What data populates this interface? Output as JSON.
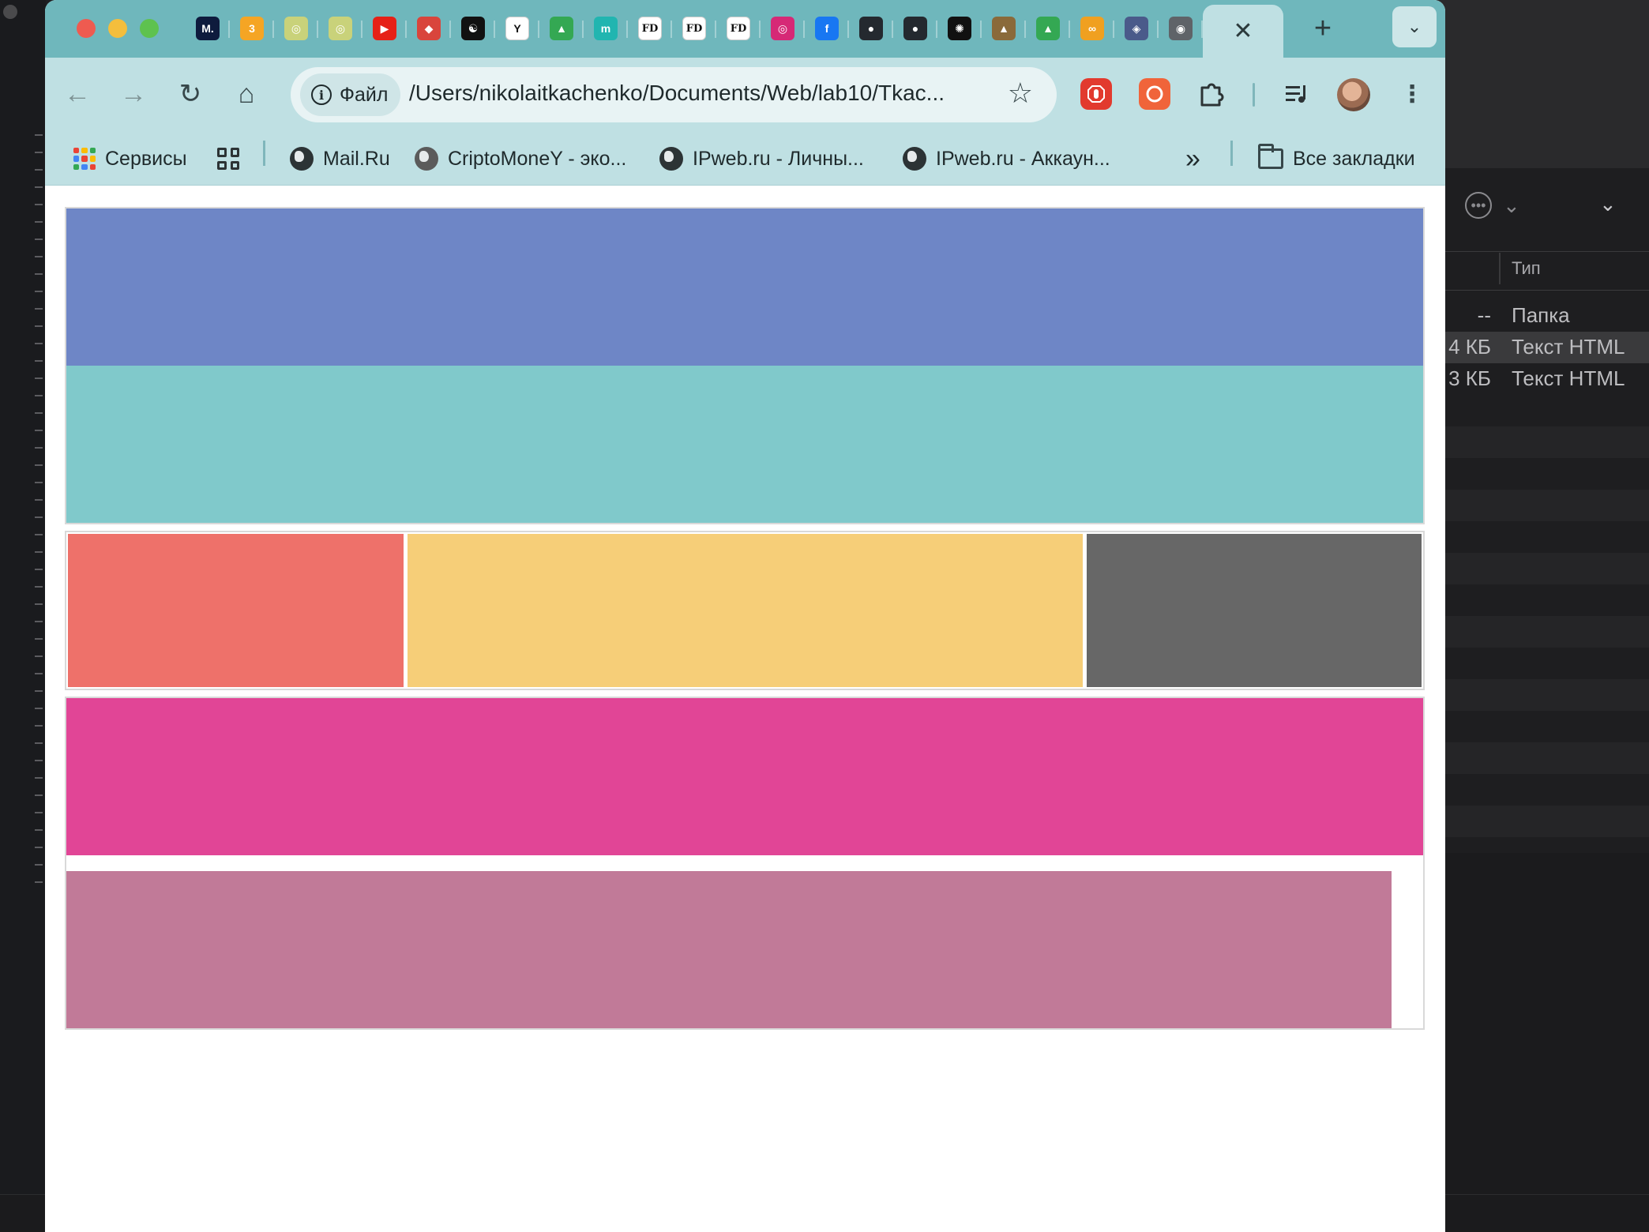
{
  "browser": {
    "tab_favicons": [
      {
        "name": "metamask-icon",
        "bg": "#0e1b3d",
        "glyph": "M."
      },
      {
        "name": "coin-icon",
        "bg": "#f5a524",
        "glyph": "3"
      },
      {
        "name": "emblem-icon",
        "bg": "#c9d27a",
        "glyph": "◎"
      },
      {
        "name": "emblem-icon",
        "bg": "#c9d27a",
        "glyph": "◎"
      },
      {
        "name": "youtube-icon",
        "bg": "#e62117",
        "glyph": "▶"
      },
      {
        "name": "fox-icon",
        "bg": "#d9453c",
        "glyph": "◆"
      },
      {
        "name": "yin-yang-icon",
        "bg": "#111111",
        "glyph": "☯"
      },
      {
        "name": "y-shield-icon",
        "bg": "#ffffff",
        "glyph": "Y"
      },
      {
        "name": "google-drive-icon",
        "bg": "#34a853",
        "glyph": "▲"
      },
      {
        "name": "m-icon",
        "bg": "#21b5b0",
        "glyph": "m"
      },
      {
        "name": "fd-icon",
        "bg": "#ffffff",
        "glyph": "FD"
      },
      {
        "name": "fd-icon",
        "bg": "#ffffff",
        "glyph": "FD"
      },
      {
        "name": "fd-icon",
        "bg": "#ffffff",
        "glyph": "FD"
      },
      {
        "name": "instagram-icon",
        "bg": "#d62976",
        "glyph": "◎"
      },
      {
        "name": "facebook-icon",
        "bg": "#1877f2",
        "glyph": "f"
      },
      {
        "name": "github-icon",
        "bg": "#24292f",
        "glyph": "●"
      },
      {
        "name": "github-icon",
        "bg": "#24292f",
        "glyph": "●"
      },
      {
        "name": "openai-icon",
        "bg": "#111111",
        "glyph": "✺"
      },
      {
        "name": "graduation-icon",
        "bg": "#8a6a3a",
        "glyph": "▲"
      },
      {
        "name": "google-drive-icon",
        "bg": "#34a853",
        "glyph": "▲"
      },
      {
        "name": "infinity-icon",
        "bg": "#f0a020",
        "glyph": "∞"
      },
      {
        "name": "shield-emblem-icon",
        "bg": "#4a5a8a",
        "glyph": "◈"
      },
      {
        "name": "chrome-icon",
        "bg": "#5f6368",
        "glyph": "◉"
      }
    ],
    "active_tab_close": "✕",
    "new_tab": "+",
    "tab_search": "⌄",
    "nav": {
      "back": "←",
      "forward": "→",
      "reload": "↻",
      "home": "⌂"
    },
    "address": {
      "chip_label": "Файл",
      "url": "/Users/nikolaitkachenko/Documents/Web/lab10/Tkac...",
      "bookmark_star": "☆"
    },
    "bookmarks": {
      "apps_label": "Сервисы",
      "items": [
        "Mail.Ru",
        "CriptoMoneY - эко...",
        "IPweb.ru - Личны...",
        "IPweb.ru - Аккаун..."
      ],
      "overflow": "»",
      "all_bookmarks": "Все закладки"
    }
  },
  "page": {
    "colors": {
      "header_top": "#6e86c6",
      "header_bottom": "#80c9cb",
      "left": "#ee716a",
      "center": "#f6ce78",
      "right": "#676767",
      "footer_top": "#e14596",
      "footer_bottom": "#c17a98"
    }
  },
  "background_app": {
    "column_header": "Тип",
    "rows": [
      {
        "size": "--",
        "type": "Папка"
      },
      {
        "size": "4 КБ",
        "type": "Текст HTML"
      },
      {
        "size": "3 КБ",
        "type": "Текст HTML"
      }
    ]
  }
}
